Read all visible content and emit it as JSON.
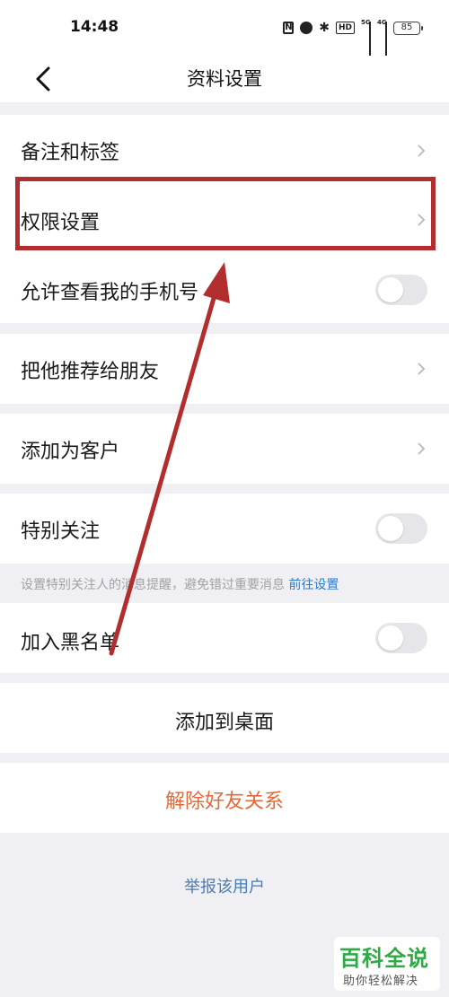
{
  "status_bar": {
    "time": "14:48",
    "nfc_label": "N",
    "hd_label": "HD",
    "signal_5g": "5G",
    "signal_4g": "4G",
    "battery": "85"
  },
  "header": {
    "title": "资料设置"
  },
  "rows": {
    "remarks_tags": "备注和标签",
    "permissions": "权限设置",
    "allow_view_phone": "允许查看我的手机号",
    "recommend_to_friend": "把他推荐给朋友",
    "add_as_customer": "添加为客户",
    "special_attention": "特别关注",
    "blacklist": "加入黑名单",
    "add_to_desktop": "添加到桌面",
    "remove_friend": "解除好友关系"
  },
  "hint": {
    "text": "设置特别关注人的消息提醒，避免错过重要消息",
    "link": "前往设置"
  },
  "toggles": {
    "allow_view_phone": false,
    "special_attention": false,
    "blacklist": false
  },
  "report_link": "举报该用户",
  "colors": {
    "remove_friend": "#e06a3b",
    "link": "#2f79c6",
    "annotation": "#b22e2e",
    "watermark": "#2fa845"
  },
  "watermark": {
    "main": "百科全说",
    "sub": "助你轻松解决"
  }
}
